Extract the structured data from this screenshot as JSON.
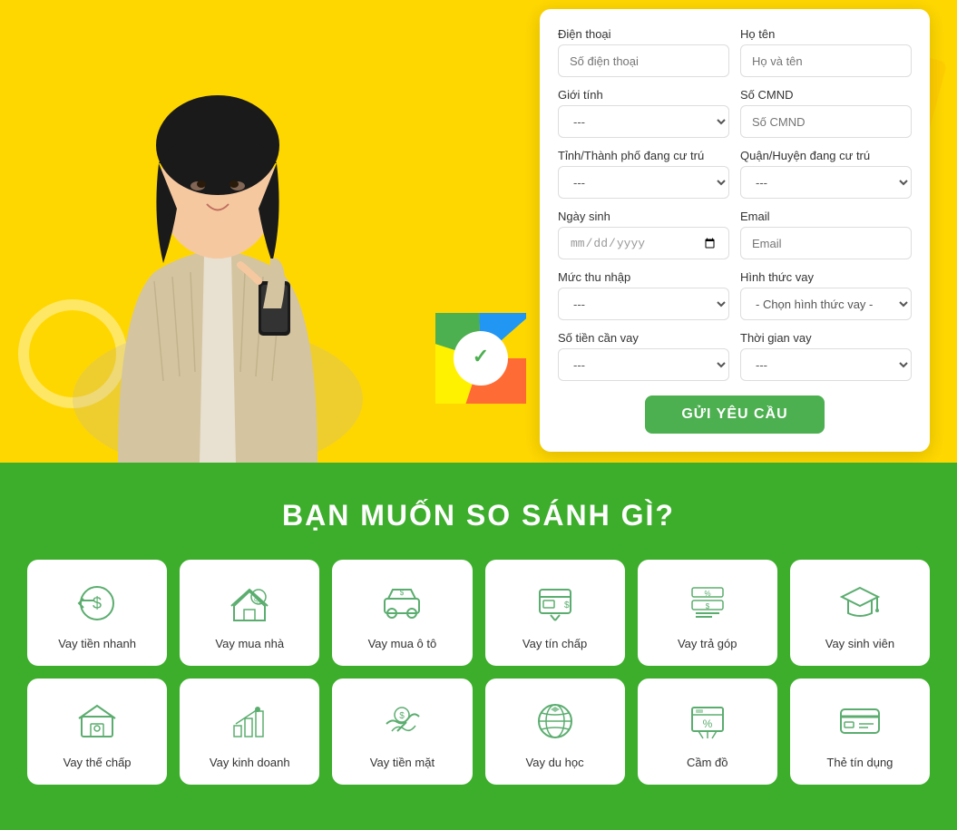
{
  "form": {
    "phone_label": "Điện thoại",
    "phone_placeholder": "Số điện thoại",
    "name_label": "Họ tên",
    "name_placeholder": "Họ và tên",
    "gender_label": "Giới tính",
    "gender_default": "---",
    "cmnd_label": "Số CMND",
    "cmnd_placeholder": "Số CMND",
    "province_label": "Tỉnh/Thành phố đang cư trú",
    "province_default": "---",
    "district_label": "Quận/Huyện đang cư trú",
    "district_default": "---",
    "dob_label": "Ngày sinh",
    "dob_placeholder": "dd/mm/yyyy",
    "email_label": "Email",
    "email_placeholder": "Email",
    "income_label": "Mức thu nhập",
    "income_default": "---",
    "loan_type_label": "Hình thức vay",
    "loan_type_default": "- Chọn hình thức vay -",
    "amount_label": "Số tiền cần vay",
    "amount_default": "---",
    "duration_label": "Thời gian vay",
    "duration_default": "---",
    "submit_label": "GỬI YÊU CẦU"
  },
  "compare_section": {
    "title": "BẠN MUỐN SO SÁNH GÌ?",
    "cards_row1": [
      {
        "label": "Vay tiền nhanh",
        "icon": "fast-money"
      },
      {
        "label": "Vay mua nhà",
        "icon": "home-loan"
      },
      {
        "label": "Vay mua ô tô",
        "icon": "car-loan"
      },
      {
        "label": "Vay tín chấp",
        "icon": "credit-loan"
      },
      {
        "label": "Vay trả góp",
        "icon": "installment"
      },
      {
        "label": "Vay sinh viên",
        "icon": "student-loan"
      }
    ],
    "cards_row2": [
      {
        "label": "Vay thế chấp",
        "icon": "mortgage"
      },
      {
        "label": "Vay kinh doanh",
        "icon": "business-loan"
      },
      {
        "label": "Vay tiền mặt",
        "icon": "cash-loan"
      },
      {
        "label": "Vay du học",
        "icon": "study-abroad"
      },
      {
        "label": "Cầm đồ",
        "icon": "pawn"
      },
      {
        "label": "Thẻ tín dụng",
        "icon": "credit-card"
      }
    ]
  }
}
